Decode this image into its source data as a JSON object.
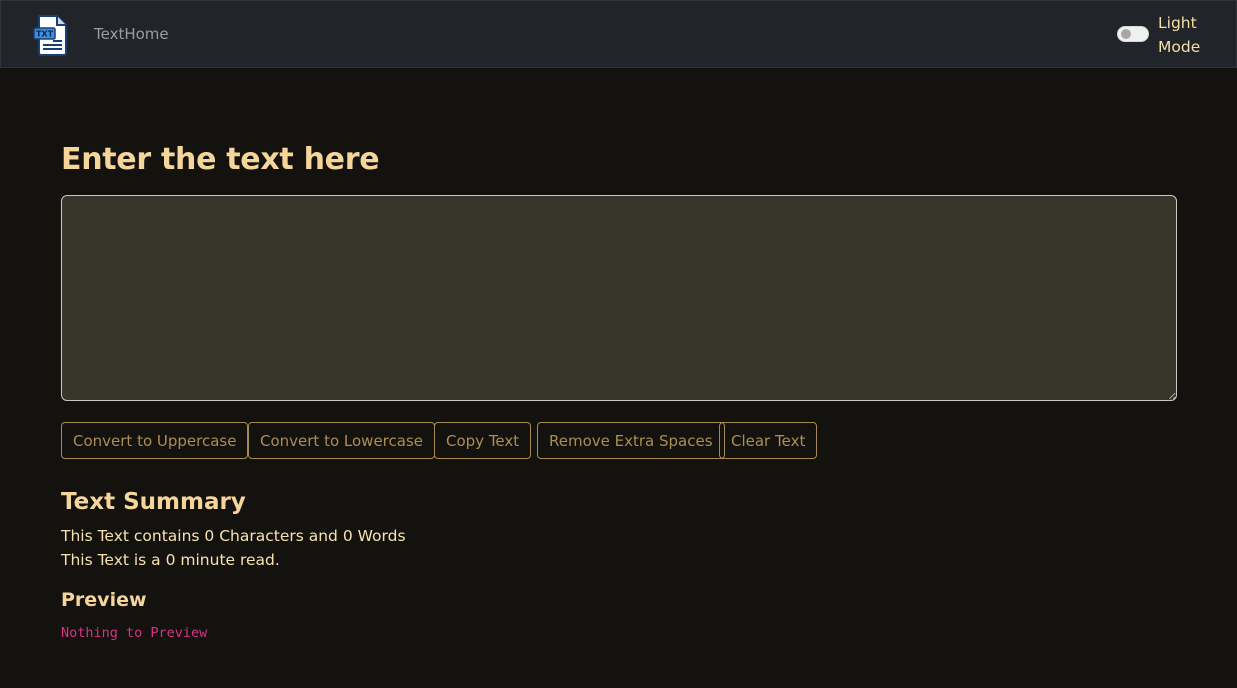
{
  "navbar": {
    "logo_text": "TXT",
    "brand": "TextHome",
    "mode_toggle_label": "Light Mode",
    "mode_toggle_checked": false
  },
  "main": {
    "heading": "Enter the text here",
    "textarea_value": "",
    "buttons": [
      "Convert to Uppercase",
      "Convert to Lowercase",
      "Copy Text",
      "Remove Extra Spaces",
      "Clear Text"
    ]
  },
  "summary": {
    "title": "Text Summary",
    "counts_line": "This Text contains 0 Characters and 0 Words",
    "read_time_line": "This Text is a 0 minute read."
  },
  "preview": {
    "title": "Preview",
    "text": "Nothing to Preview"
  },
  "colors": {
    "navbar_bg": "#212529",
    "page_bg": "#13120e",
    "heading": "#f6d59b",
    "button_border": "#a68a4f",
    "preview_text": "#d63384"
  }
}
